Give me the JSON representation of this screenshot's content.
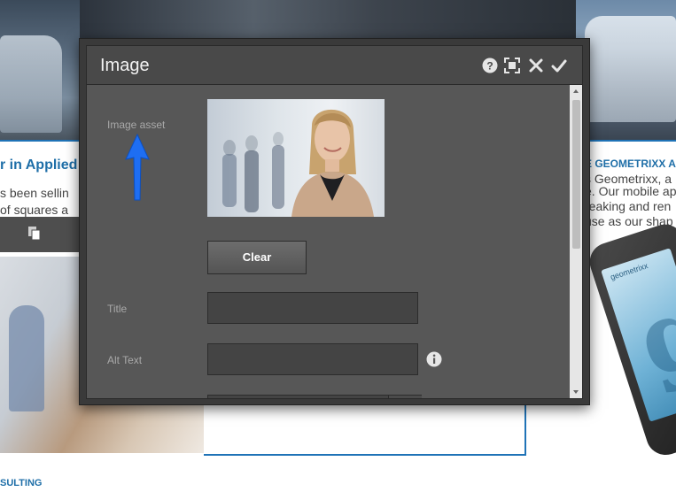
{
  "background_page": {
    "heading_left": "r in Applied",
    "text_left": [
      "s been sellin",
      "of squares a"
    ],
    "heading_right": "E GEOMETRIXX A",
    "text_right": [
      "s Geometrixx, a",
      "e. Our mobile ap",
      "reaking and ren",
      "use as our shap"
    ],
    "phone_brand": "geometrixx",
    "phone_letter": "g",
    "footer_title": "SULTING"
  },
  "dialog": {
    "title": "Image",
    "header_icons": [
      "help-icon",
      "fullscreen-icon",
      "close-icon",
      "check-icon"
    ],
    "fields": {
      "image_asset_label": "Image asset",
      "clear_label": "Clear",
      "title_label": "Title",
      "title_value": "",
      "alt_text_label": "Alt Text",
      "alt_text_value": ""
    }
  },
  "colors": {
    "accent_blue": "#1f73b7",
    "dialog_bg": "#575757",
    "dialog_header": "#494949",
    "arrow": "#1e6ef2"
  }
}
